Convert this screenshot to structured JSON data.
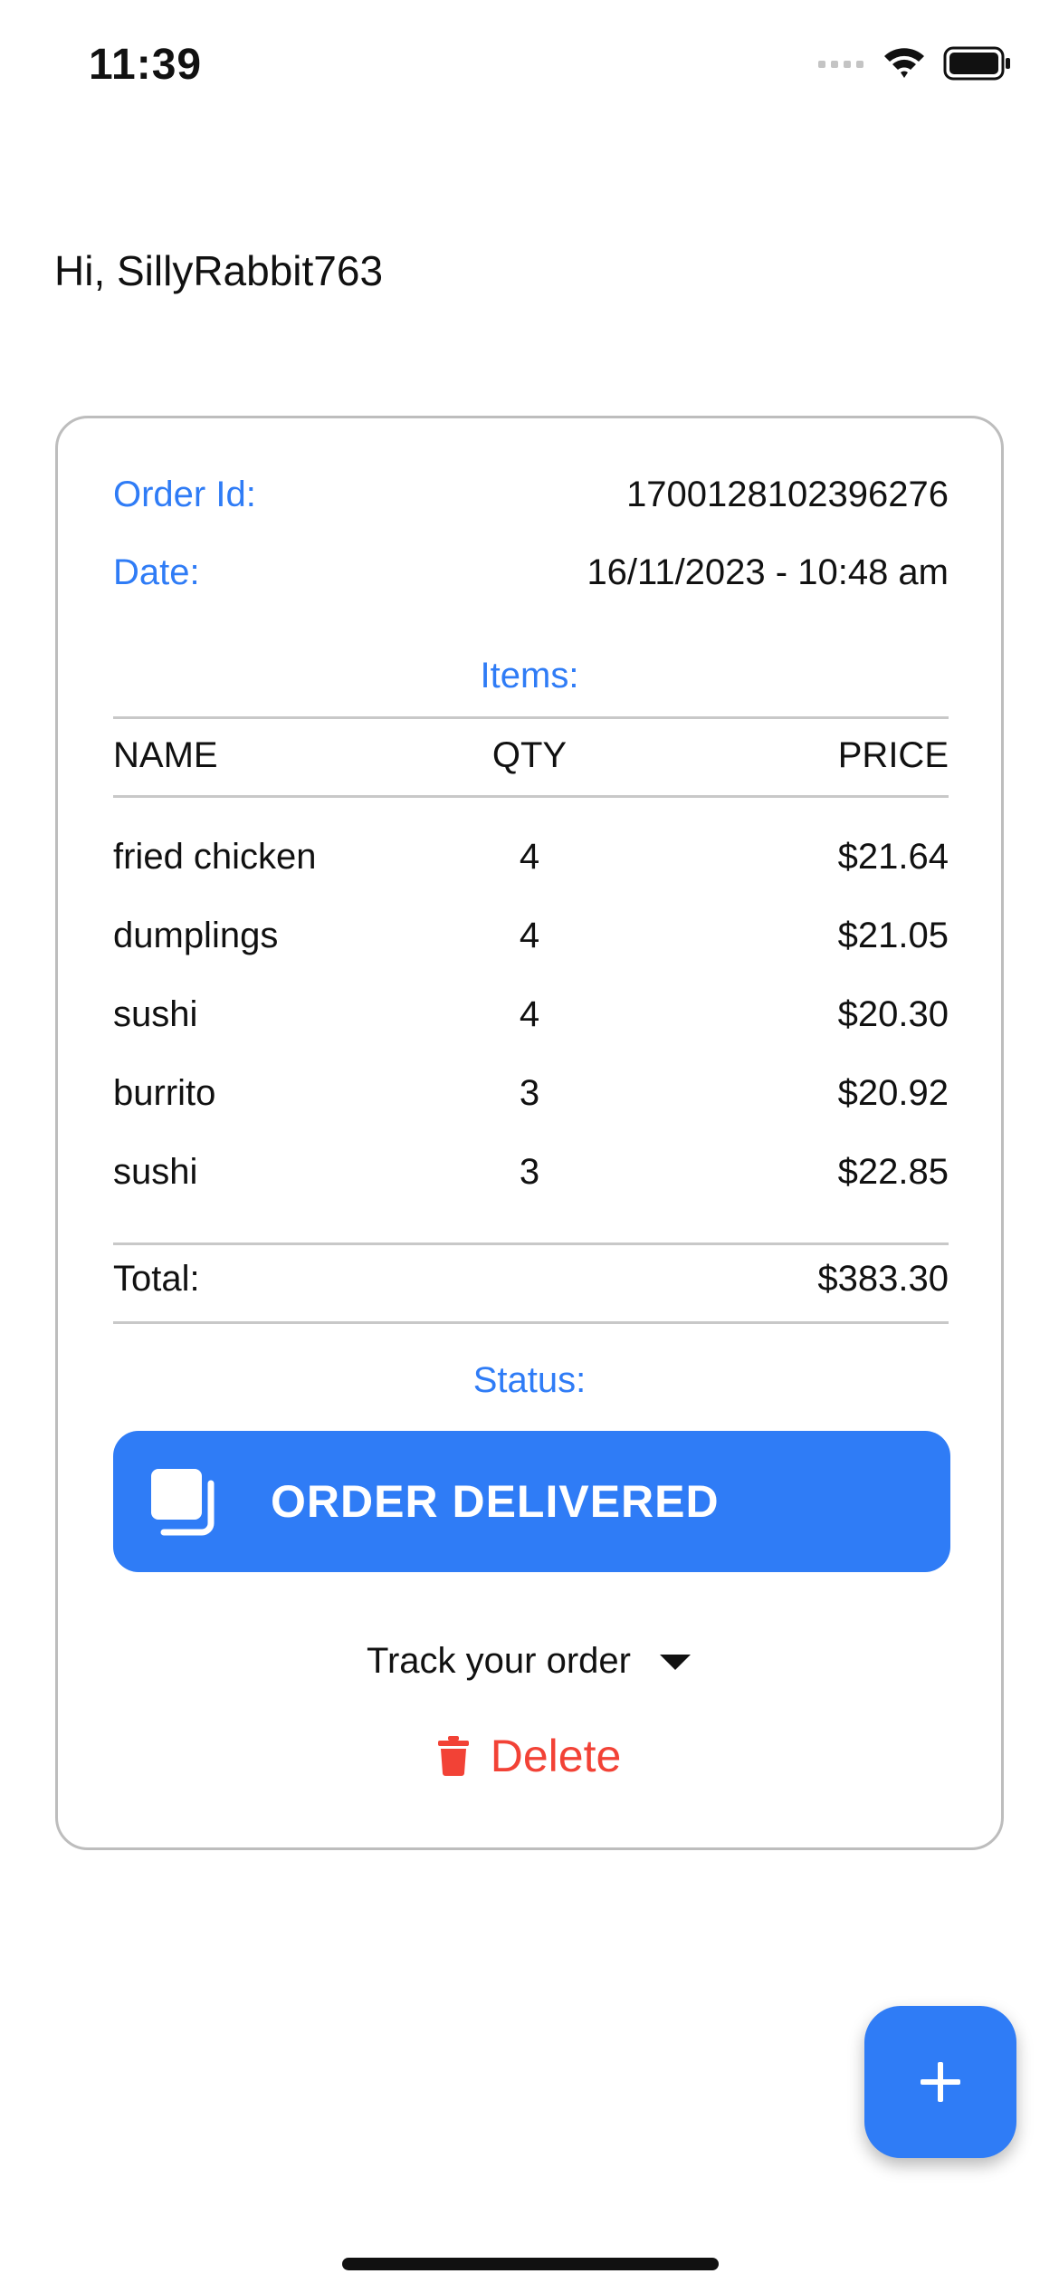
{
  "status_bar": {
    "time": "11:39",
    "icons": [
      "signal-icon",
      "wifi-icon",
      "battery-icon"
    ]
  },
  "greeting": "Hi, SillyRabbit763",
  "order": {
    "id_label": "Order Id:",
    "id_value": "1700128102396276",
    "date_label": "Date:",
    "date_value": "16/11/2023 - 10:48 am",
    "items_title": "Items:",
    "columns": {
      "name": "NAME",
      "qty": "QTY",
      "price": "PRICE"
    },
    "items": [
      {
        "name": "fried chicken",
        "qty": "4",
        "price": "$21.64"
      },
      {
        "name": "dumplings",
        "qty": "4",
        "price": "$21.05"
      },
      {
        "name": "sushi",
        "qty": "4",
        "price": "$20.30"
      },
      {
        "name": "burrito",
        "qty": "3",
        "price": "$20.92"
      },
      {
        "name": "sushi",
        "qty": "3",
        "price": "$22.85"
      }
    ],
    "total_label": "Total:",
    "total_value": "$383.30",
    "status_title": "Status:",
    "status_label": "ORDER DELIVERED",
    "track_label": "Track your order",
    "delete_label": "Delete"
  },
  "colors": {
    "accent": "#2f7cf6",
    "danger": "#f24236",
    "border": "#bdbdbd"
  }
}
